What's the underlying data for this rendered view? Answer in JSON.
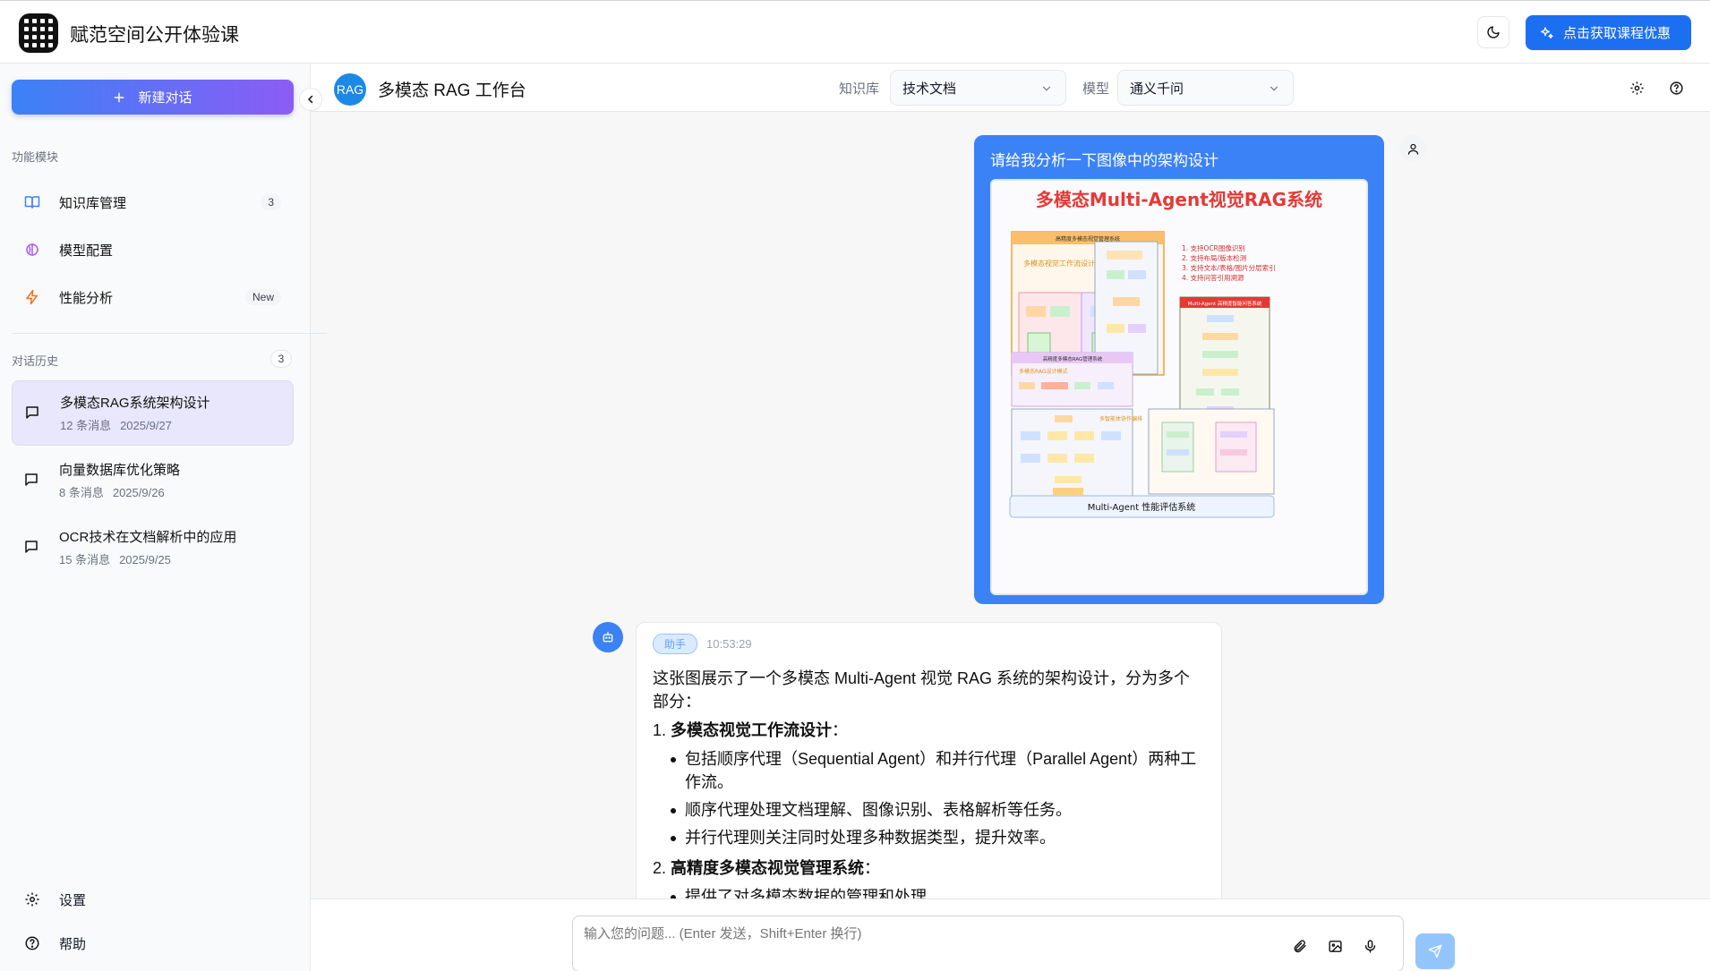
{
  "app": {
    "title": "赋范空间公开体验课"
  },
  "topbar": {
    "promo_label": "点击获取课程优惠"
  },
  "sidebar": {
    "new_chat_label": "新建对话",
    "modules_title": "功能模块",
    "modules": [
      {
        "label": "知识库管理",
        "badge": "3",
        "icon": "book-open-icon"
      },
      {
        "label": "模型配置",
        "badge": "",
        "icon": "brain-icon"
      },
      {
        "label": "性能分析",
        "badge": "New",
        "icon": "zap-icon"
      }
    ],
    "history_title": "对话历史",
    "history_count": "3",
    "history": [
      {
        "title": "多模态RAG系统架构设计",
        "messages": "12 条消息",
        "date": "2025/9/27"
      },
      {
        "title": "向量数据库优化策略",
        "messages": "8 条消息",
        "date": "2025/9/26"
      },
      {
        "title": "OCR技术在文档解析中的应用",
        "messages": "15 条消息",
        "date": "2025/9/25"
      }
    ],
    "footer": {
      "settings_label": "设置",
      "help_label": "帮助"
    }
  },
  "header": {
    "badge": "RAG",
    "title": "多模态 RAG 工作台",
    "kb_label": "知识库",
    "kb_value": "技术文档",
    "model_label": "模型",
    "model_value": "通义千问"
  },
  "chat": {
    "user_message": "请给我分析一下图像中的架构设计",
    "image": {
      "title": "多模态Multi-Agent视觉RAG系统",
      "panel_top": "高精度多模态视觉管理系统",
      "panel_sub": "多模态视觉工作流设计",
      "features": [
        "1. 支持OCR图像识别",
        "2. 支持布局/版本检测",
        "3. 支持文本/表格/图片分层索引",
        "4. 支持问答引用溯源"
      ],
      "panel_right": "Multi-Agent 高精度智能问答系统",
      "panel_mid": "高精度多模态RAG管理系统",
      "panel_mid_sub": "多模态RAG设计模式",
      "panel_mid_sub2": "多智能体协作编排",
      "footer": "Multi-Agent 性能评估系统"
    },
    "assistant": {
      "tag": "助手",
      "time": "10:53:29",
      "intro": "这张图展示了一个多模态 Multi-Agent 视觉 RAG 系统的架构设计，分为多个部分：",
      "section1_num": "1.",
      "section1_title": "多模态视觉工作流设计",
      "section1_colon": "：",
      "section1_points": [
        "包括顺序代理（Sequential Agent）和并行代理（Parallel Agent）两种工作流。",
        "顺序代理处理文档理解、图像识别、表格解析等任务。",
        "并行代理则关注同时处理多种数据类型，提升效率。"
      ],
      "section2_num": "2.",
      "section2_title": "高精度多模态视觉管理系统",
      "section2_colon": "：",
      "section2_points": [
        "提供了对多模态数据的管理和处理"
      ]
    }
  },
  "input": {
    "placeholder": "输入您的问题... (Enter 发送，Shift+Enter 换行)"
  },
  "colors": {
    "accent": "#3b82f6",
    "promo": "#1d6ff2",
    "gradient_start": "#3b82f6",
    "gradient_end": "#8b5cf6"
  }
}
